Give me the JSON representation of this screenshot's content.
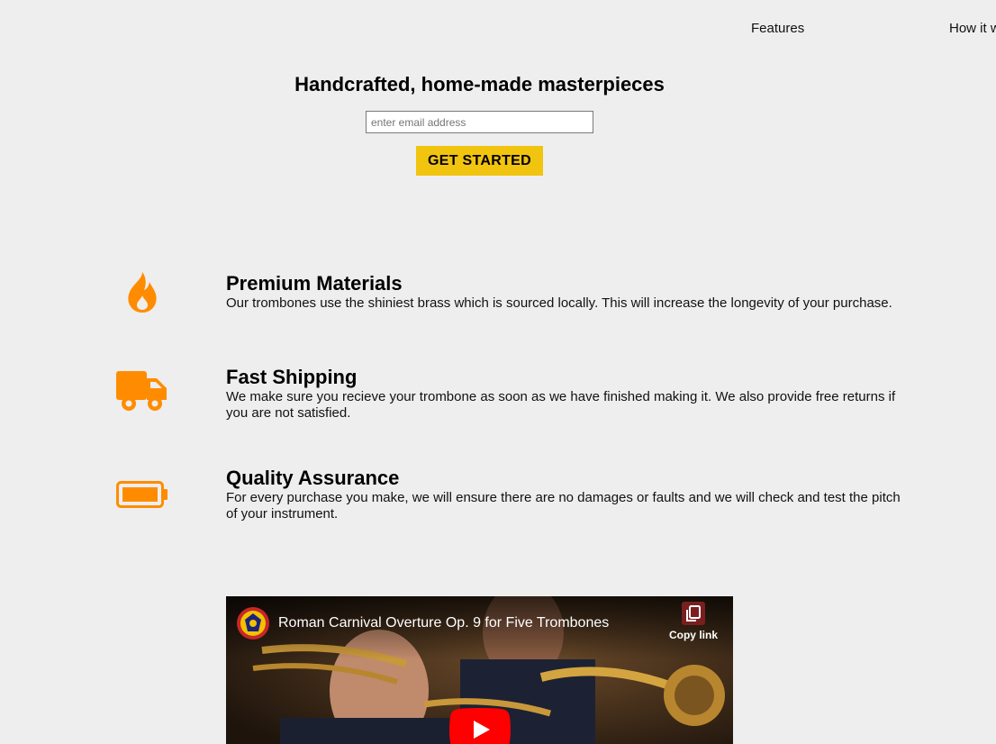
{
  "nav": {
    "features": "Features",
    "how_it_works": "How it w"
  },
  "hero": {
    "title": "Handcrafted, home-made masterpieces",
    "email_placeholder": "enter email address",
    "button_label": "GET STARTED"
  },
  "features": [
    {
      "icon": "fire-icon",
      "title": "Premium Materials",
      "description": "Our trombones use the shiniest brass which is sourced locally. This will increase the longevity of your purchase."
    },
    {
      "icon": "truck-icon",
      "title": "Fast Shipping",
      "description": "We make sure you recieve your trombone as soon as we have finished making it. We also provide free returns if you are not satisfied."
    },
    {
      "icon": "battery-full-icon",
      "title": "Quality Assurance",
      "description": "For every purchase you make, we will ensure there are no damages or faults and we will check and test the pitch of your instrument."
    }
  ],
  "video": {
    "title": "Roman Carnival Overture Op. 9 for Five Trombones",
    "copy_link_label": "Copy link"
  },
  "colors": {
    "accent_icon": "#ff8c00",
    "cta_button": "#f1c40f",
    "background": "#eeeeee",
    "youtube_red": "#ff0000"
  }
}
